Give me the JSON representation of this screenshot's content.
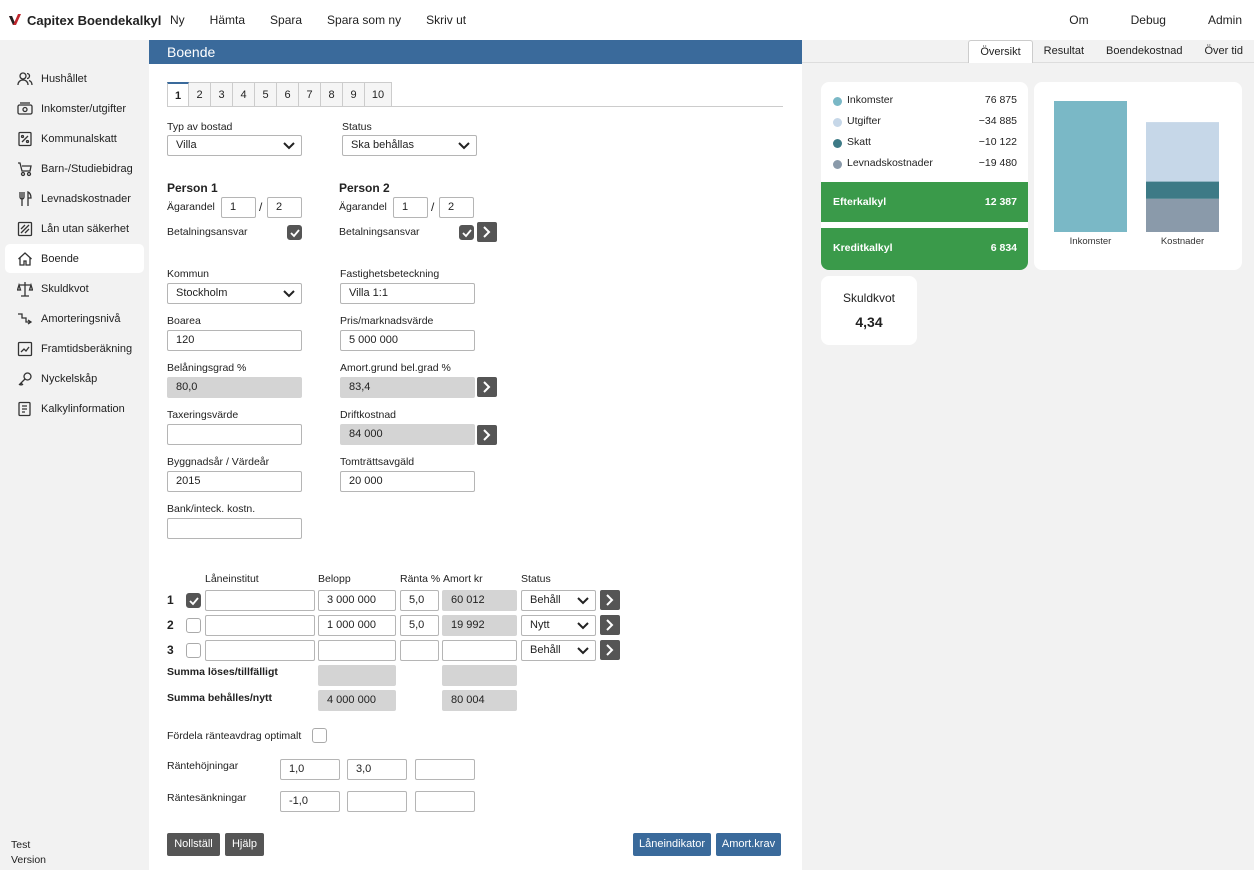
{
  "app": {
    "title": "Capitex Boendekalkyl"
  },
  "topnav": {
    "items": [
      "Ny",
      "Hämta",
      "Spara",
      "Spara som ny",
      "Skriv ut"
    ],
    "right": [
      "Om",
      "Debug",
      "Admin"
    ]
  },
  "sidebar": {
    "items": [
      {
        "label": "Hushållet",
        "icon": "users-icon"
      },
      {
        "label": "Inkomster/utgifter",
        "icon": "money-icon"
      },
      {
        "label": "Kommunalskatt",
        "icon": "tax-icon"
      },
      {
        "label": "Barn-/Studiebidrag",
        "icon": "stroller-icon"
      },
      {
        "label": "Levnadskostnader",
        "icon": "cutlery-icon"
      },
      {
        "label": "Lån utan säkerhet",
        "icon": "loan-icon"
      },
      {
        "label": "Boende",
        "icon": "house-icon"
      },
      {
        "label": "Skuldkvot",
        "icon": "balance-icon"
      },
      {
        "label": "Amorteringsnivå",
        "icon": "stairs-icon"
      },
      {
        "label": "Framtidsberäkning",
        "icon": "chart-icon"
      },
      {
        "label": "Nyckelskåp",
        "icon": "key-icon"
      },
      {
        "label": "Kalkylinformation",
        "icon": "info-icon"
      }
    ],
    "active": "Boende",
    "footer_1": "Test",
    "footer_2": "Version"
  },
  "main": {
    "header": "Boende",
    "tabs": [
      "1",
      "2",
      "3",
      "4",
      "5",
      "6",
      "7",
      "8",
      "9",
      "10"
    ],
    "typ_label": "Typ av bostad",
    "typ_value": "Villa",
    "status_label": "Status",
    "status_value": "Ska behållas",
    "person1": "Person 1",
    "person2": "Person 2",
    "agarandel": "Ägarandel",
    "p1_num": "1",
    "p1_den": "2",
    "p2_num": "1",
    "p2_den": "2",
    "slash": "/",
    "betalningsansvar": "Betalningsansvar",
    "kommun_label": "Kommun",
    "kommun_value": "Stockholm",
    "fastighet_label": "Fastighetsbeteckning",
    "fastighet_value": "Villa 1:1",
    "boarea_label": "Boarea",
    "boarea_value": "120",
    "pris_label": "Pris/marknadsvärde",
    "pris_value": "5 000 000",
    "belaning_label": "Belåningsgrad %",
    "belaning_value": "80,0",
    "amort_label": "Amort.grund bel.grad %",
    "amort_value": "83,4",
    "taxering_label": "Taxeringsvärde",
    "taxering_value": "",
    "drift_label": "Driftkostnad",
    "drift_value": "84 000",
    "bygg_label": "Byggnadsår / Värdeår",
    "bygg_value": "2015",
    "tomt_label": "Tomträttsavgäld",
    "tomt_value": "20 000",
    "bank_label": "Bank/inteck. kostn.",
    "bank_value": "",
    "loan_headers": {
      "inst": "Låneinstitut",
      "belopp": "Belopp",
      "ranta": "Ränta %",
      "amort": "Amort kr",
      "status": "Status"
    },
    "loans": [
      {
        "num": "1",
        "inst": "",
        "belopp": "3 000 000",
        "ranta": "5,0",
        "amort": "60 012",
        "status": "Behåll",
        "checked": true
      },
      {
        "num": "2",
        "inst": "",
        "belopp": "1 000 000",
        "ranta": "5,0",
        "amort": "19 992",
        "status": "Nytt",
        "checked": false
      },
      {
        "num": "3",
        "inst": "",
        "belopp": "",
        "ranta": "",
        "amort": "",
        "status": "Behåll",
        "checked": false
      }
    ],
    "summa_loses": "Summa löses/tillfälligt",
    "summa_loses_belopp": "",
    "summa_loses_amort": "",
    "summa_behalles": "Summa behålles/nytt",
    "summa_behalles_belopp": "4 000 000",
    "summa_behalles_amort": "80 004",
    "fordela": "Fördela ränteavdrag optimalt",
    "hojningar_label": "Räntehöjningar",
    "hojningar": [
      "1,0",
      "3,0",
      ""
    ],
    "sankningar_label": "Räntesänkningar",
    "sankningar": [
      "-1,0",
      "",
      ""
    ],
    "buttons": {
      "nollstall": "Nollställ",
      "hjalp": "Hjälp",
      "laneindikator": "Låneindikator",
      "amortkrav": "Amort.krav"
    }
  },
  "right": {
    "tabs": [
      "Översikt",
      "Resultat",
      "Boendekostnad",
      "Över tid"
    ],
    "summary": [
      {
        "name": "Inkomster",
        "value": "76 875",
        "color": "#7ab8c6"
      },
      {
        "name": "Utgifter",
        "value": "−34 885",
        "color": "#c6d7e8"
      },
      {
        "name": "Skatt",
        "value": "−10 122",
        "color": "#3d7a86"
      },
      {
        "name": "Levnadskostnader",
        "value": "−19 480",
        "color": "#8a9aaa"
      }
    ],
    "efterkalkyl": "Efterkalkyl",
    "efterkalkyl_value": "12 387",
    "kreditkalkyl": "Kreditkalkyl",
    "kreditkalkyl_value": "6 834",
    "skuldkvot": "Skuldkvot",
    "skuldkvot_value": "4,34"
  },
  "chart_data": {
    "type": "bar",
    "categories": [
      "Inkomster",
      "Kostnader"
    ],
    "series": [
      {
        "name": "Inkomster",
        "values": [
          76875,
          0
        ],
        "color": "#7ab8c6"
      },
      {
        "name": "Levnadskostnader",
        "values": [
          0,
          19480
        ],
        "color": "#8a9aaa"
      },
      {
        "name": "Skatt",
        "values": [
          0,
          10122
        ],
        "color": "#3d7a86"
      },
      {
        "name": "Utgifter",
        "values": [
          0,
          34885
        ],
        "color": "#c6d7e8"
      }
    ],
    "stacked": true,
    "ylim": [
      0,
      76875
    ],
    "grid": false
  }
}
